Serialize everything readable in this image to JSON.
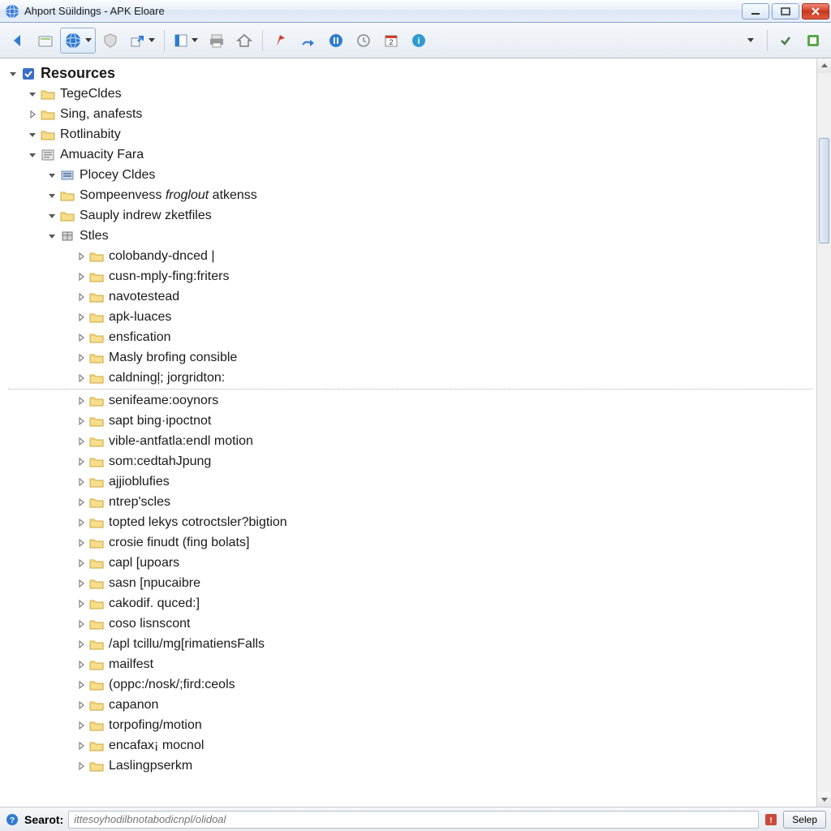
{
  "window": {
    "title": "Ahport Süildings - APK Eloare"
  },
  "toolbar": {
    "buttons": [
      {
        "name": "back",
        "dd": false,
        "framed": false
      },
      {
        "name": "file",
        "dd": false,
        "framed": false
      },
      {
        "name": "globe",
        "dd": true,
        "framed": true
      },
      {
        "name": "shield",
        "dd": false,
        "framed": false
      },
      {
        "name": "export",
        "dd": true,
        "framed": false
      },
      {
        "name": "panel",
        "dd": true,
        "framed": false
      },
      {
        "name": "print",
        "dd": false,
        "framed": false
      },
      {
        "name": "home",
        "dd": false,
        "framed": false
      },
      {
        "name": "flag",
        "dd": false,
        "framed": false
      },
      {
        "name": "run",
        "dd": false,
        "framed": false
      },
      {
        "name": "pause",
        "dd": false,
        "framed": false
      },
      {
        "name": "clock",
        "dd": false,
        "framed": false
      },
      {
        "name": "calendar",
        "dd": false,
        "framed": false
      },
      {
        "name": "info",
        "dd": false,
        "framed": false
      }
    ],
    "right": [
      {
        "name": "more",
        "dd": true
      },
      {
        "name": "check",
        "dd": false
      },
      {
        "name": "util",
        "dd": false
      }
    ]
  },
  "tree": {
    "root": {
      "label": "Resources",
      "expanded": true,
      "icon": "box-check"
    },
    "level1": [
      {
        "label": "TegeCldes",
        "expanded": true,
        "icon": "folder"
      },
      {
        "label": "Sing, anafests",
        "expanded": false,
        "icon": "folder"
      },
      {
        "label": "Rotlinabity",
        "expanded": true,
        "icon": "folder"
      },
      {
        "label": "Amuacity Fara",
        "expanded": true,
        "icon": "doc"
      }
    ],
    "level2": [
      {
        "label": "Plocey Cldes",
        "expanded": true,
        "icon": "block"
      },
      {
        "label": "Sompeenvess froglout atkenss",
        "expanded": true,
        "icon": "folder",
        "italic": true
      },
      {
        "label": "Sauply indrew zketfiles",
        "expanded": true,
        "icon": "folder",
        "italic_tail": true
      },
      {
        "label": "Stles",
        "expanded": true,
        "icon": "box"
      }
    ],
    "level3": [
      {
        "label": "colobandy-dnced |"
      },
      {
        "label": "cusn-mply-fing:friters"
      },
      {
        "label": "navotestead"
      },
      {
        "label": "apk-luaces"
      },
      {
        "label": "ensfication"
      },
      {
        "label": "Masly brofing consible"
      },
      {
        "label": "caldningļ; jorgridton:"
      },
      {
        "label": "senifeame:ooynors",
        "divider_before": true
      },
      {
        "label": "sapt bing·ipoctnot"
      },
      {
        "label": "vible-antfatla:endl motion"
      },
      {
        "label": "som:cedtahJpung"
      },
      {
        "label": "ajjioblufies"
      },
      {
        "label": "ntrep'scles"
      },
      {
        "label": "topted lekys cotroctsler?bigtion"
      },
      {
        "label": "crosie finudt (fing bolats]"
      },
      {
        "label": "capl [upoars"
      },
      {
        "label": "sasn [npucaibre"
      },
      {
        "label": "cakodif. quced:]"
      },
      {
        "label": "coso lisnscont"
      },
      {
        "label": "/apl tcillu/mg[rimatiensFalls"
      },
      {
        "label": "mailfest"
      },
      {
        "label": "(opрc:/nosk/;fird:ceols"
      },
      {
        "label": "capanon"
      },
      {
        "label": "torpofing/motion"
      },
      {
        "label": "encafax¡ mocnol"
      },
      {
        "label": "Laslingpserkm"
      }
    ]
  },
  "search": {
    "label": "Searot:",
    "placeholder": "ittesoyhodilbnotabodicnpl/olidoal",
    "button": "Selep"
  }
}
